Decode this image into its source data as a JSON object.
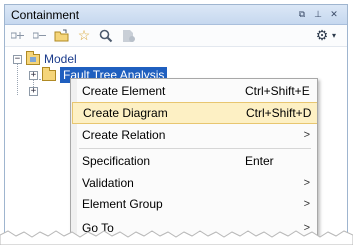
{
  "panel": {
    "title": "Containment",
    "window_buttons": [
      "restore-icon",
      "pin-icon",
      "close-icon"
    ],
    "window_button_glyphs": [
      "⧉",
      "⊥",
      "✕"
    ]
  },
  "toolbar": {
    "icons": [
      "collapse-all-icon",
      "expand-all-icon",
      "open-folder-icon",
      "favorite-star-icon",
      "search-icon",
      "element-icon",
      "gear-icon",
      "dropdown-arrow-icon"
    ]
  },
  "tree": {
    "model_label": "Model",
    "selected_label": "Fault Tree Analysis",
    "expander_glyph": "+",
    "collapser_glyph": "−"
  },
  "context_menu": {
    "items": [
      {
        "label": "Create Element",
        "shortcut": "Ctrl+Shift+E",
        "submenu": false
      },
      {
        "label": "Create Diagram",
        "shortcut": "Ctrl+Shift+D",
        "submenu": false,
        "highlighted": true
      },
      {
        "label": "Create Relation",
        "shortcut": "",
        "submenu": true,
        "arrow": ">"
      },
      {
        "label": "Specification",
        "shortcut": "Enter",
        "submenu": false
      },
      {
        "label": "Validation",
        "shortcut": "",
        "submenu": true,
        "arrow": ">"
      },
      {
        "label": "Element Group",
        "shortcut": "",
        "submenu": true,
        "arrow": ">"
      },
      {
        "label": "Go To",
        "shortcut": "",
        "submenu": true,
        "arrow": ">"
      }
    ]
  },
  "colors": {
    "selection": "#1f5fbf",
    "menu_highlight": "#fdf0c4",
    "title_bar": "#c6d8ef"
  }
}
